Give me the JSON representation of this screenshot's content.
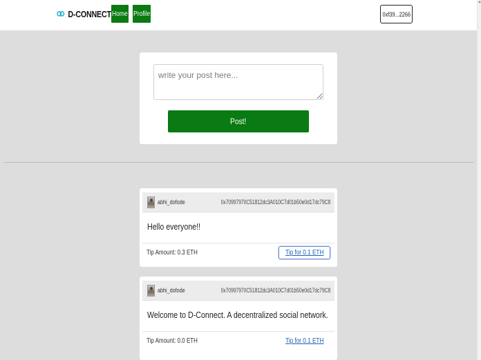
{
  "navbar": {
    "brand": "D-CONNECT",
    "home_label": "Home",
    "profile_label": "Profile",
    "account_address": "0xf39...2266"
  },
  "compose": {
    "placeholder": "write your post here...",
    "post_button_label": "Post!"
  },
  "posts": [
    {
      "username": "abhi_dofode",
      "address": "0x70997970C51812dc3A010C7d01b50e0d17dc79C8",
      "content": "Hello everyone!!",
      "tip_amount": "Tip Amount: 0.3 ETH",
      "tip_button_label": "Tip for 0.1 ETH"
    },
    {
      "username": "abhi_dofode",
      "address": "0x70997970C51812dc3A010C7d01b50e0d17dc79C8",
      "content": "Welcome to D-Connect. A decentralized social network.",
      "tip_amount": "Tip Amount: 0.0 ETH",
      "tip_button_label": "Tip for 0.1 ETH"
    }
  ],
  "colors": {
    "accent_green": "#0a7a12",
    "link_blue": "#1a5fb4",
    "page_background": "#dddddd"
  },
  "icons": {
    "brand": "link-chain-icon",
    "avatar": "user-avatar"
  }
}
